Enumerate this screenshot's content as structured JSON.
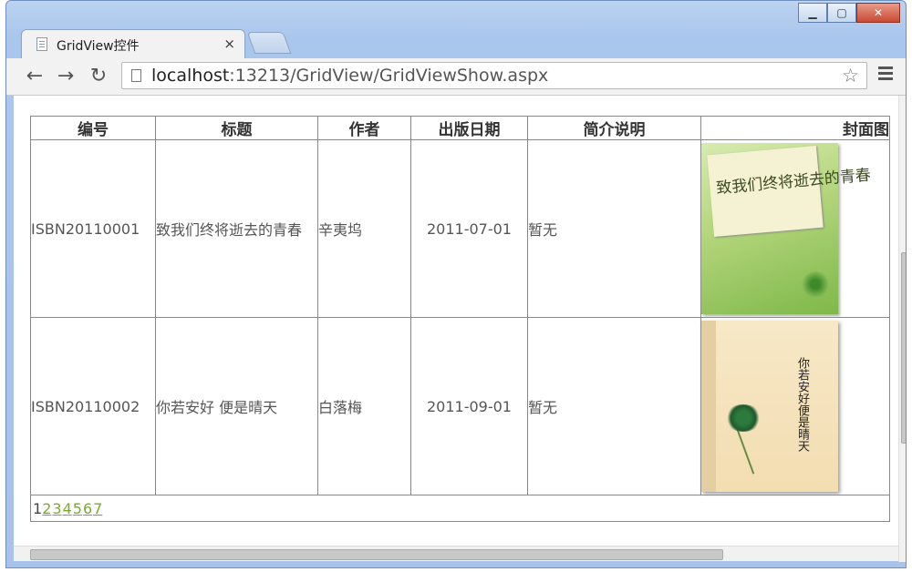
{
  "browser": {
    "tab_title": "GridView控件",
    "tab_close": "×",
    "url_host": "localhost",
    "url_rest": ":13213/GridView/GridViewShow.aspx",
    "nav": {
      "back": "←",
      "forward": "→",
      "reload": "↻"
    },
    "star": "☆",
    "window_buttons": {
      "minimize": "▁",
      "maximize": "▢",
      "close": "✕"
    }
  },
  "grid": {
    "headers": [
      "编号",
      "标题",
      "作者",
      "出版日期",
      "简介说明",
      "封面图"
    ],
    "rows": [
      {
        "isbn": "ISBN20110001",
        "title": "致我们终将逝去的青春",
        "author": "辛夷坞",
        "date": "2011-07-01",
        "desc": "暂无",
        "cover_icon": "book-cover-green"
      },
      {
        "isbn": "ISBN20110002",
        "title": "你若安好 便是晴天",
        "author": "白落梅",
        "date": "2011-09-01",
        "desc": "暂无",
        "cover_icon": "book-cover-beige"
      }
    ],
    "pager": {
      "current": "1",
      "links": [
        "2",
        "3",
        "4",
        "5",
        "6",
        "7"
      ]
    }
  },
  "colors": {
    "isbn": "#c0392b",
    "author": "#1a1aa0",
    "pager_link": "#7aaa2a"
  }
}
